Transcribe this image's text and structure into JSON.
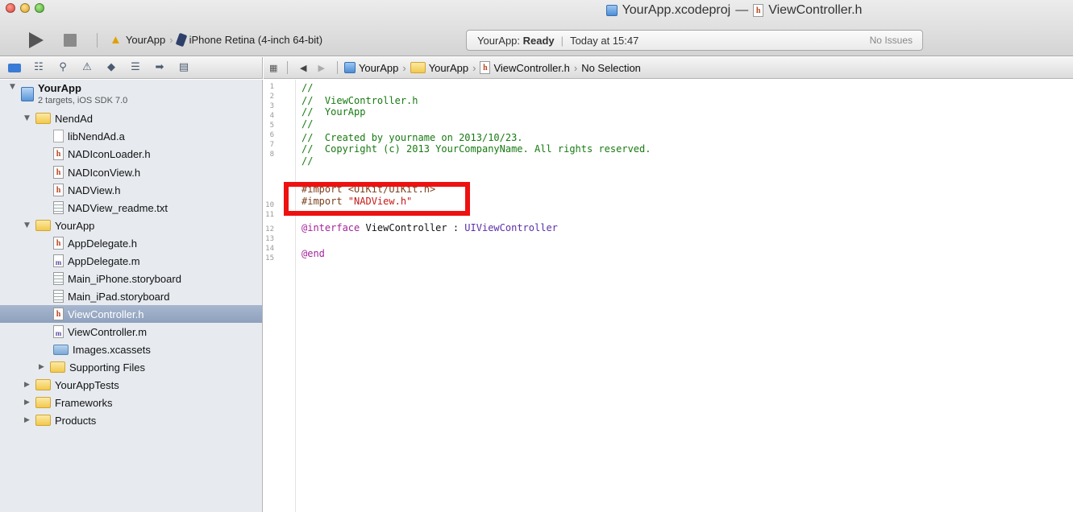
{
  "window": {
    "title_project": "YourApp.xcodeproj",
    "title_dash": "—",
    "title_file": "ViewController.h"
  },
  "toolbar": {
    "scheme": "YourApp",
    "destination": "iPhone Retina (4-inch 64-bit)",
    "activity_prefix": "YourApp:",
    "activity_status": "Ready",
    "activity_time": "Today at 15:47",
    "activity_issues": "No Issues"
  },
  "navigator": {
    "project_name": "YourApp",
    "project_detail": "2 targets, iOS SDK 7.0",
    "items": [
      {
        "label": "NendAd"
      },
      {
        "label": "libNendAd.a"
      },
      {
        "label": "NADIconLoader.h"
      },
      {
        "label": "NADIconView.h"
      },
      {
        "label": "NADView.h"
      },
      {
        "label": "NADView_readme.txt"
      },
      {
        "label": "YourApp"
      },
      {
        "label": "AppDelegate.h"
      },
      {
        "label": "AppDelegate.m"
      },
      {
        "label": "Main_iPhone.storyboard"
      },
      {
        "label": "Main_iPad.storyboard"
      },
      {
        "label": "ViewController.h"
      },
      {
        "label": "ViewController.m"
      },
      {
        "label": "Images.xcassets"
      },
      {
        "label": "Supporting Files"
      },
      {
        "label": "YourAppTests"
      },
      {
        "label": "Frameworks"
      },
      {
        "label": "Products"
      }
    ]
  },
  "jump_bar": {
    "crumb1": "YourApp",
    "crumb2": "YourApp",
    "crumb3": "ViewController.h",
    "crumb4": "No Selection"
  },
  "editor": {
    "line_numbers": [
      "1",
      "2",
      "3",
      "4",
      "5",
      "6",
      "7",
      "8",
      "",
      "10",
      "11",
      "12",
      "13",
      "14",
      "15"
    ],
    "lines": {
      "l1": "//",
      "l2": "//  ViewController.h",
      "l3": "//  YourApp",
      "l4": "//",
      "l5": "//  Created by yourname on 2013/10/23.",
      "l6": "//  Copyright (c) 2013 YourCompanyName. All rights reserved.",
      "l7": "//",
      "l9": "#import <UIKit/UIKit.h>",
      "l10_directive": "#import ",
      "l10_string": "\"NADView.h\"",
      "l12_keyword": "@interface",
      "l12_name": " ViewController : ",
      "l12_super": "UIViewController",
      "l14": "@end"
    }
  },
  "colors": {
    "highlight": "#ee1111",
    "comment": "#177a12",
    "string": "#c41a16",
    "keyword": "#a4249a",
    "selection": "#8ea1bd"
  }
}
